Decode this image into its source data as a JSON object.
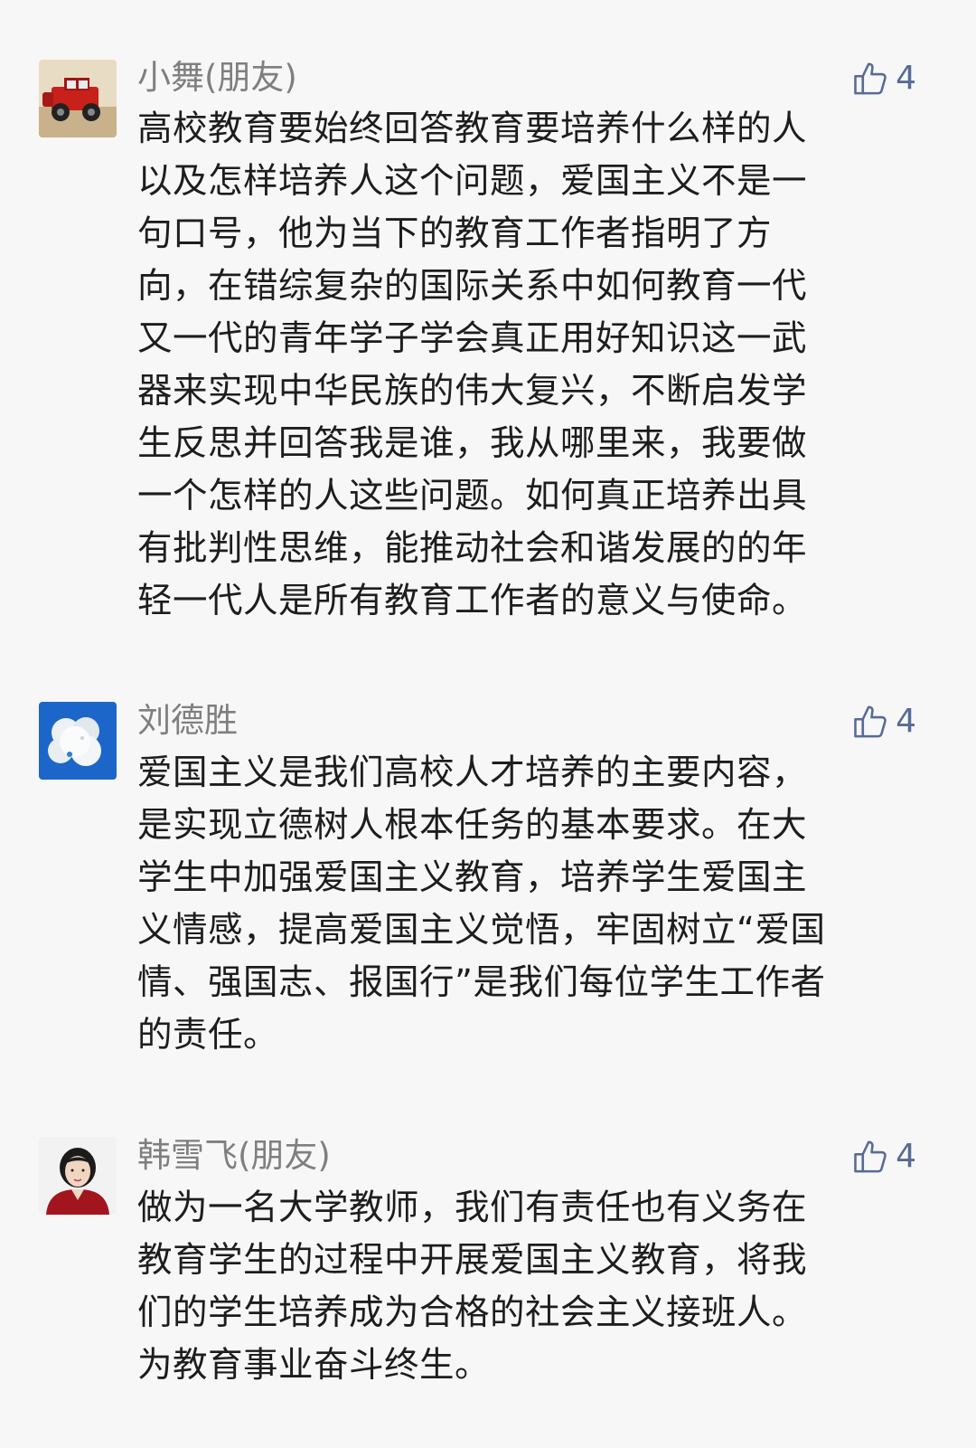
{
  "comments": [
    {
      "author": "小舞(朋友)",
      "avatar_icon": "red-jeep-avatar",
      "likes": "4",
      "text": "高校教育要始终回答教育要培养什么样的人\n以及怎样培养人这个问题，爱国主义不是一\n句口号，他为当下的教育工作者指明了方\n向，在错综复杂的国际关系中如何教育一代\n又一代的青年学子学会真正用好知识这一武\n器来实现中华民族的伟大复兴，不断启发学\n生反思并回答我是谁，我从哪里来，我要做\n一个怎样的人这些问题。如何真正培养出具\n有批判性思维，能推动社会和谐发展的的年\n轻一代人是所有教育工作者的意义与使命。"
    },
    {
      "author": "刘德胜",
      "avatar_icon": "jade-pendant-avatar",
      "likes": "4",
      "text": "爱国主义是我们高校人才培养的主要内容，\n是实现立德树人根本任务的基本要求。在大\n学生中加强爱国主义教育，培养学生爱国主\n义情感，提高爱国主义觉悟，牢固树立“爱国\n情、强国志、报国行”是我们每位学生工作者\n的责任。"
    },
    {
      "author": "韩雪飞(朋友)",
      "avatar_icon": "woman-portrait-avatar",
      "likes": "4",
      "text": "做为一名大学教师，我们有责任也有义务在\n教育学生的过程中开展爱国主义教育，将我\n们的学生培养成为合格的社会主义接班人。\n为教育事业奋斗终生。"
    }
  ],
  "colors": {
    "background": "#f7f7f7",
    "author": "#7f7f7f",
    "body_text": "#1d1d1d",
    "like_accent": "#576b95"
  }
}
